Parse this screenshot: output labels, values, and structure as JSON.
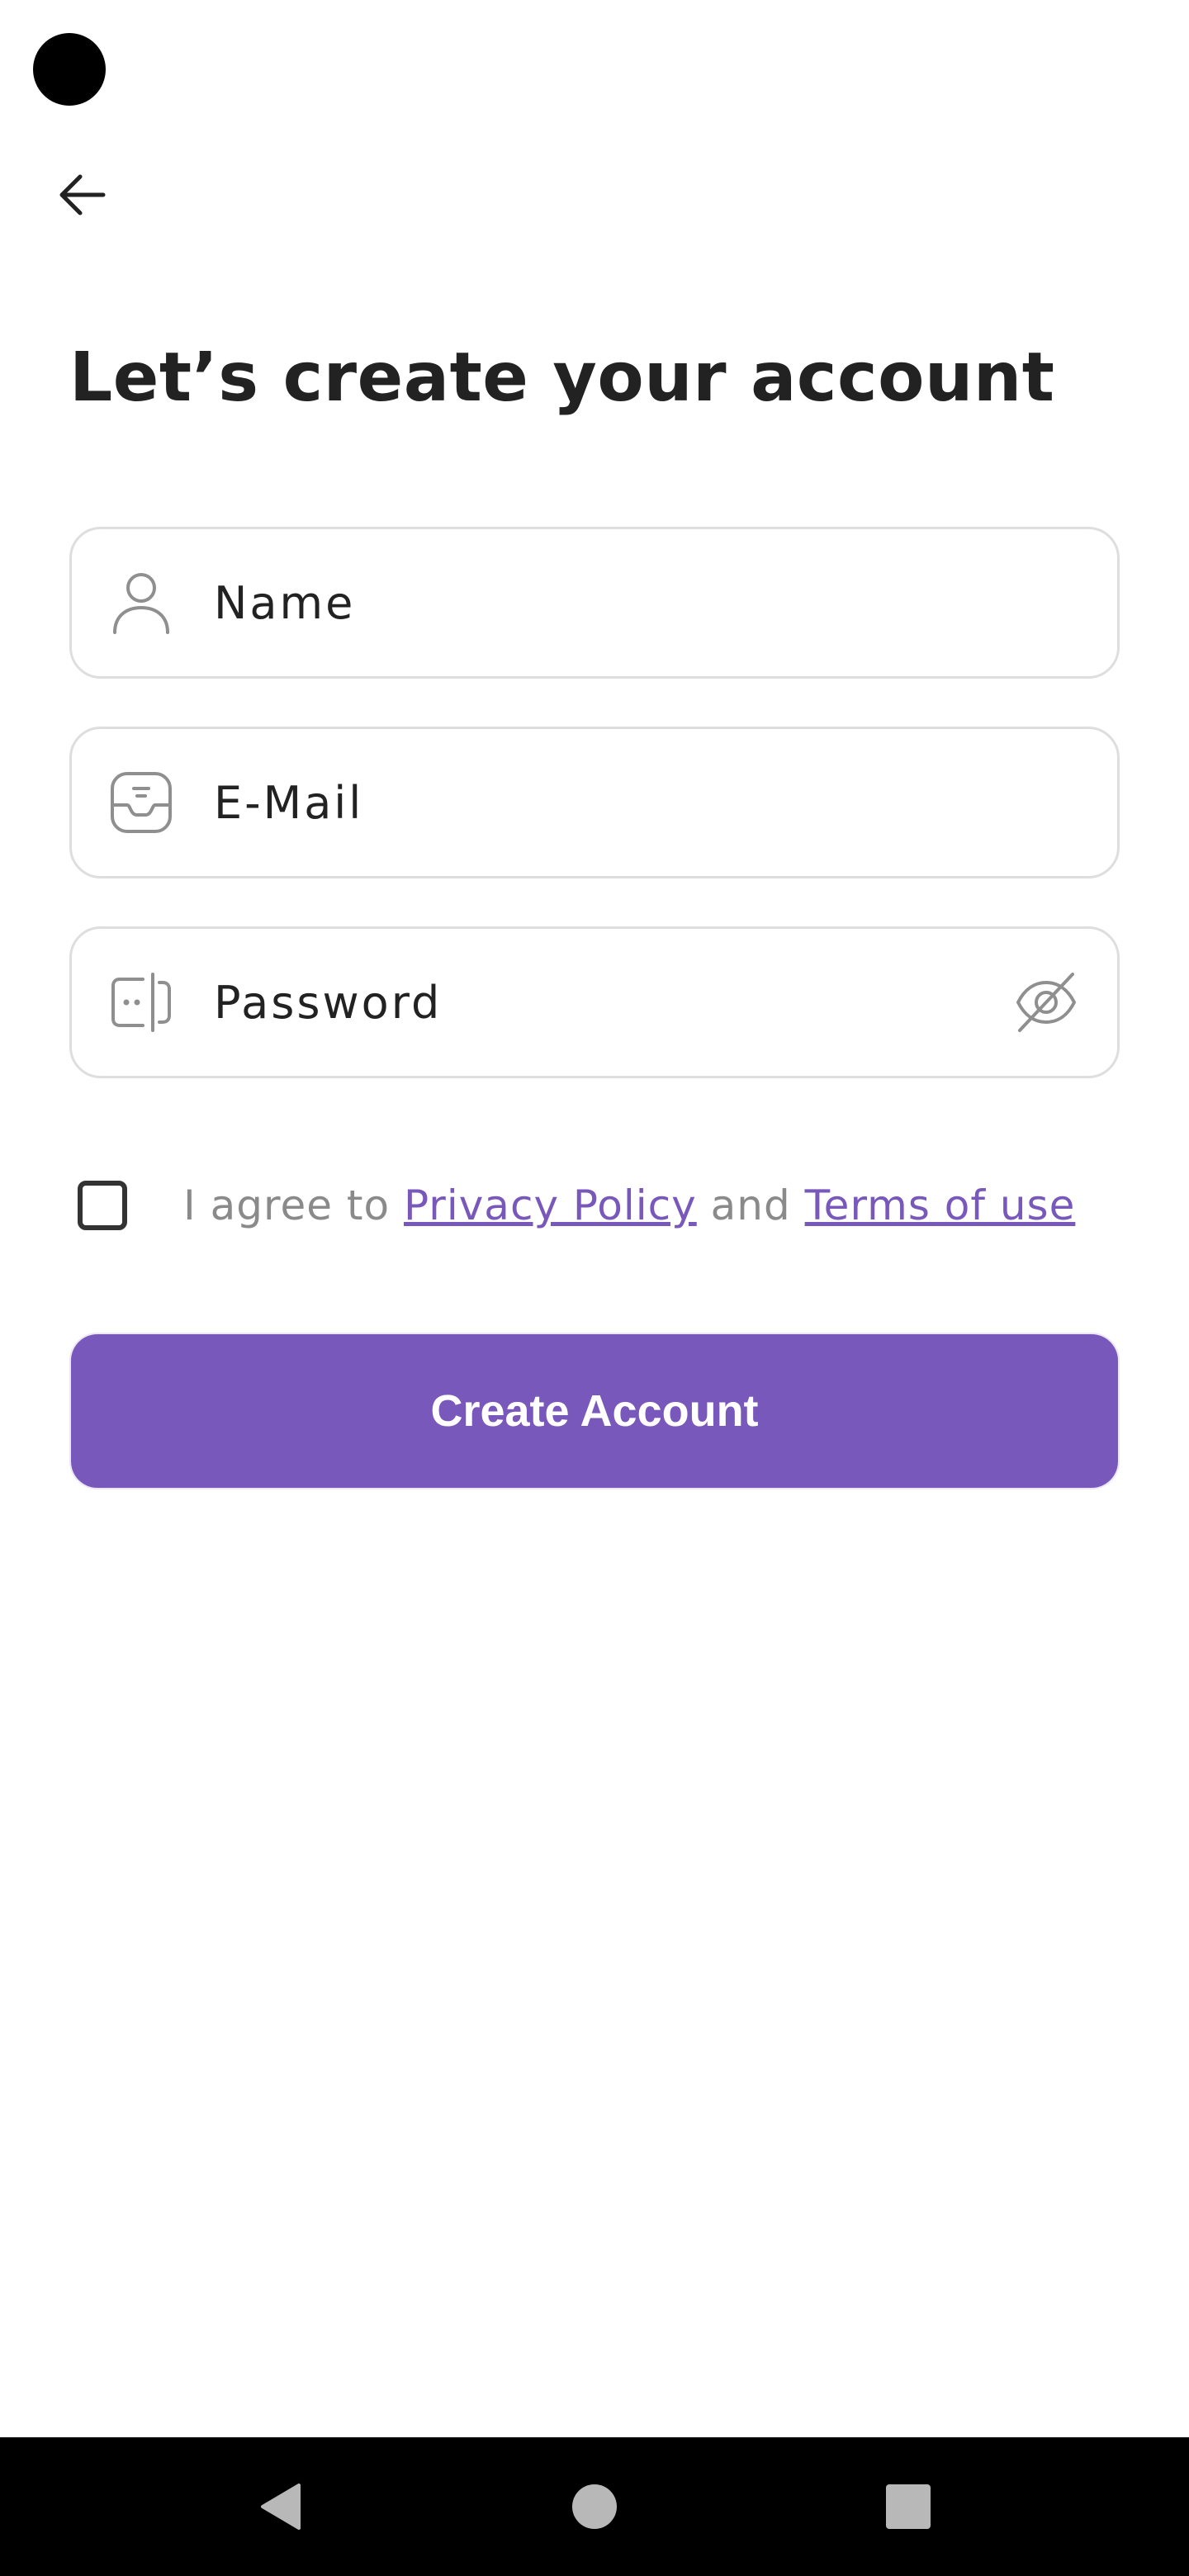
{
  "header": {
    "back_icon": "arrow-left-icon"
  },
  "page": {
    "title": "Let’s create your account"
  },
  "form": {
    "name": {
      "placeholder": "Name",
      "value": "",
      "icon": "user-icon"
    },
    "email": {
      "placeholder": "E-Mail",
      "value": "",
      "icon": "inbox-icon"
    },
    "password": {
      "placeholder": "Password",
      "value": "",
      "icon": "password-icon",
      "toggle_icon": "eye-off-icon"
    },
    "agreement": {
      "checked": false,
      "prefix": "I agree to",
      "privacy_link": "Privacy Policy",
      "connector": "and",
      "terms_link": "Terms of use"
    },
    "submit_label": "Create Account"
  },
  "nav_bar": {
    "back_icon": "nav-back-icon",
    "home_icon": "nav-home-icon",
    "recents_icon": "nav-recents-icon"
  },
  "colors": {
    "accent": "#7958bc",
    "text_primary": "#222222",
    "text_muted": "#8a8a8a",
    "field_border": "#dedede",
    "icon_gray": "#8f8f8f"
  }
}
